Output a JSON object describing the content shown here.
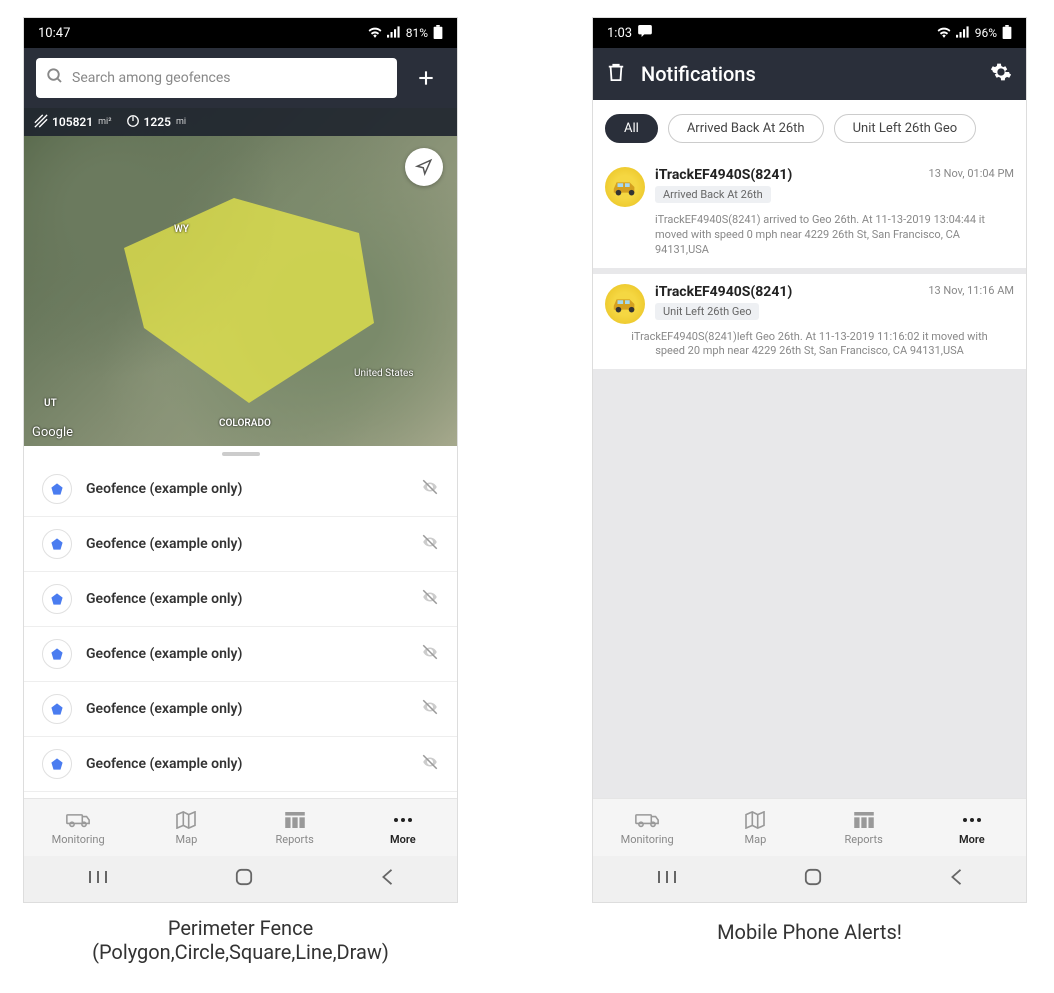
{
  "left": {
    "statusbar": {
      "time": "10:47",
      "battery": "81%"
    },
    "search": {
      "placeholder": "Search among geofences"
    },
    "map": {
      "area_val": "105821",
      "area_unit": "mi²",
      "perim_val": "1225",
      "perim_unit": "mi",
      "label_wy": "WY",
      "label_us": "United States",
      "label_ut": "UT",
      "label_co": "COLORADO",
      "google": "Google"
    },
    "geofences": [
      {
        "label": "Geofence (example only)"
      },
      {
        "label": "Geofence (example only)"
      },
      {
        "label": "Geofence (example only)"
      },
      {
        "label": "Geofence (example only)"
      },
      {
        "label": "Geofence (example only)"
      },
      {
        "label": "Geofence (example only)"
      }
    ],
    "nav": {
      "monitoring": "Monitoring",
      "map": "Map",
      "reports": "Reports",
      "more": "More"
    },
    "caption_line1": "Perimeter Fence",
    "caption_line2": "(Polygon,Circle,Square,Line,Draw)"
  },
  "right": {
    "statusbar": {
      "time": "1:03",
      "battery": "96%"
    },
    "header": {
      "title": "Notifications"
    },
    "filters": {
      "all": "All",
      "f1": "Arrived Back At 26th",
      "f2": "Unit Left 26th Geo"
    },
    "notifs": [
      {
        "title": "iTrackEF4940S(8241)",
        "tag": "Arrived Back At 26th",
        "time": "13 Nov, 01:04 PM",
        "body": "iTrackEF4940S(8241) arrived to Geo 26th.     At 11-13-2019 13:04:44 it moved with speed 0 mph near 4229 26th St, San Francisco, CA 94131,USA"
      },
      {
        "title": "iTrackEF4940S(8241)",
        "tag": "Unit Left 26th Geo",
        "time": "13 Nov, 11:16 AM",
        "body": "iTrackEF4940S(8241)left Geo 26th.     At 11-13-2019 11:16:02 it moved with speed 20 mph near 4229 26th St, San Francisco, CA 94131,USA"
      }
    ],
    "nav": {
      "monitoring": "Monitoring",
      "map": "Map",
      "reports": "Reports",
      "more": "More"
    },
    "caption": "Mobile Phone Alerts!"
  }
}
